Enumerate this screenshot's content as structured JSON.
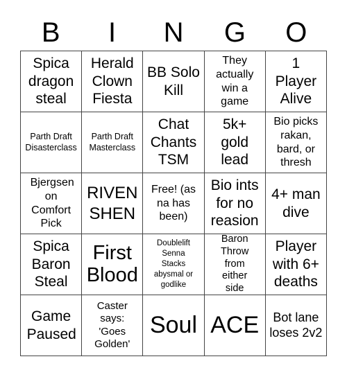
{
  "header": {
    "letters": [
      "B",
      "I",
      "N",
      "G",
      "O"
    ]
  },
  "cells": [
    {
      "text": "Spica dragon steal"
    },
    {
      "text": "Herald Clown Fiesta"
    },
    {
      "text": "BB Solo Kill"
    },
    {
      "text": "They actually win a game"
    },
    {
      "text": "1 Player Alive"
    },
    {
      "text": "Parth Draft Disasterclass"
    },
    {
      "text": "Parth Draft Masterclass"
    },
    {
      "text": "Chat Chants TSM"
    },
    {
      "text": "5k+ gold lead"
    },
    {
      "text": "Bio picks rakan, bard, or thresh"
    },
    {
      "text": "Bjergsen on Comfort Pick"
    },
    {
      "text": "RIVEN SHEN"
    },
    {
      "text": "Free! (as na has been)"
    },
    {
      "text": "Bio ints for no reasion"
    },
    {
      "text": "4+ man dive"
    },
    {
      "text": "Spica Baron Steal"
    },
    {
      "text": "First Blood"
    },
    {
      "text": "Doublelift Senna Stacks abysmal or godlike"
    },
    {
      "text": "Baron Throw from either side"
    },
    {
      "text": "Player with 6+ deaths"
    },
    {
      "text": "Game Paused"
    },
    {
      "text": "Caster says: 'Goes Golden'"
    },
    {
      "text": "Soul"
    },
    {
      "text": "ACE"
    },
    {
      "text": "Bot lane loses 2v2"
    }
  ]
}
